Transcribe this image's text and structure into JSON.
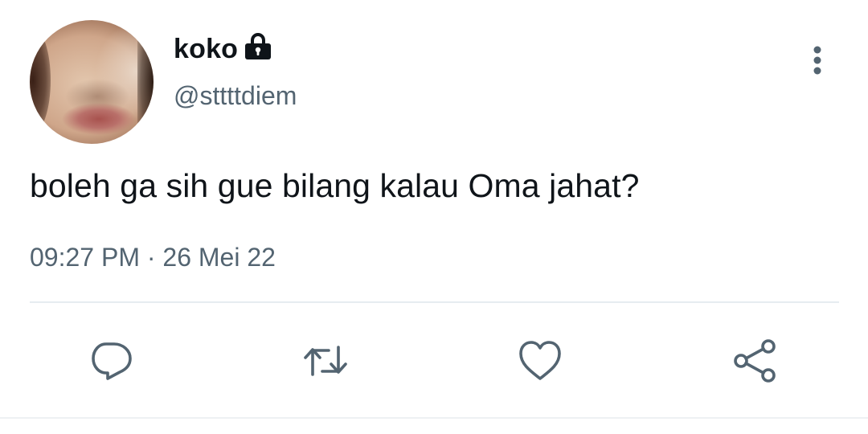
{
  "tweet": {
    "display_name": "koko",
    "handle": "@sttttdiem",
    "text": "boleh ga sih gue bilang kalau Oma jahat?",
    "time": "09:27 PM",
    "separator": "·",
    "date": "26 Mei 22"
  },
  "icons": {
    "account": "lock-icon",
    "menu": "more-vertical-icon",
    "actions": [
      "reply-icon",
      "retweet-icon",
      "like-icon",
      "share-icon"
    ]
  },
  "colors": {
    "text_primary": "#0f1419",
    "text_secondary": "#536471",
    "icon": "#536471",
    "divider": "#e6ecf0",
    "background": "#ffffff"
  }
}
